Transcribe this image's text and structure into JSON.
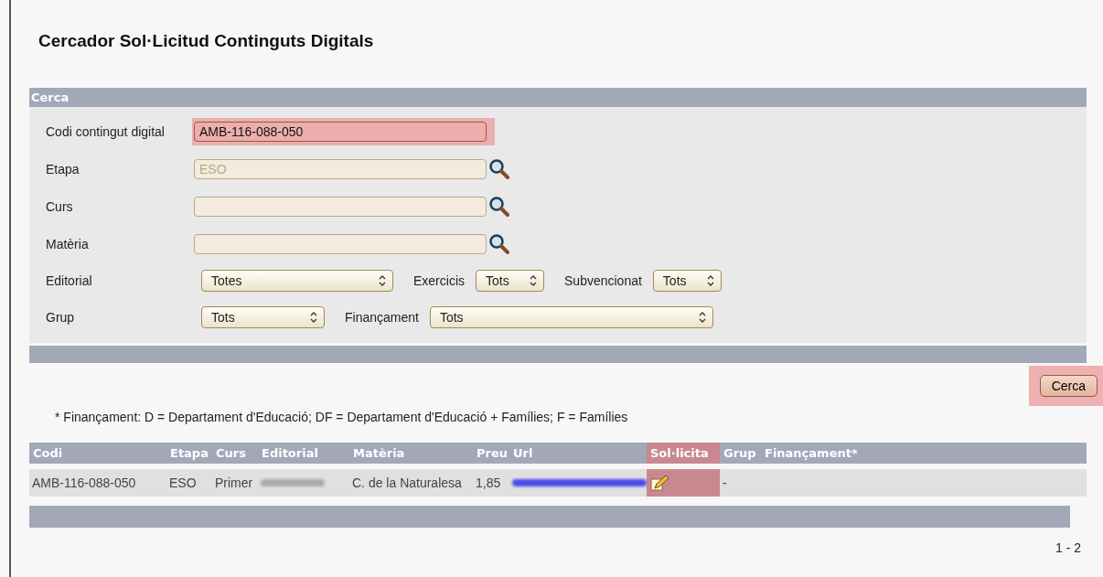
{
  "title": "Cercador Sol·Licitud Continguts Digitals",
  "search_section": {
    "heading": "Cerca",
    "text_fields": [
      {
        "label": "Codi contingut digital",
        "value": "AMB-116-088-050",
        "kind": "text",
        "highlighted": true
      },
      {
        "label": "Etapa",
        "value": "ESO",
        "kind": "lookup",
        "highlighted": false
      },
      {
        "label": "Curs",
        "kind": "lookup",
        "highlighted": false
      },
      {
        "label": "Matèria",
        "kind": "lookup",
        "highlighted": false
      }
    ],
    "select_rows": [
      [
        {
          "label": "Editorial",
          "value": "Totes"
        },
        {
          "label": "Exercicis",
          "value": "Tots"
        },
        {
          "label": "Subvencionat",
          "value": "Tots"
        }
      ],
      [
        {
          "label": "Grup",
          "value": "Tots"
        },
        {
          "label": "Finançament",
          "value": "Tots"
        }
      ]
    ]
  },
  "search_button": {
    "label": "Cerca",
    "highlighted": true
  },
  "footnote": "* Finançament: D = Departament d'Educació; DF = Departament d'Educació + Famílies; F = Famílies",
  "table": {
    "columns": [
      {
        "label": "Codi",
        "highlighted": false
      },
      {
        "label": "Etapa",
        "highlighted": false
      },
      {
        "label": "Curs",
        "highlighted": false
      },
      {
        "label": "Editorial",
        "highlighted": false
      },
      {
        "label": "Matèria",
        "highlighted": false
      },
      {
        "label": "Preu",
        "highlighted": false
      },
      {
        "label": "Url",
        "highlighted": false
      },
      {
        "label": "Sol·licita",
        "highlighted": true
      },
      {
        "label": "Grup",
        "highlighted": false
      },
      {
        "label": "Finançament*",
        "highlighted": false
      }
    ],
    "rows": [
      {
        "cells": [
          {
            "kind": "text",
            "text": "AMB-116-088-050"
          },
          {
            "kind": "text",
            "text": "ESO"
          },
          {
            "kind": "text",
            "text": "Primer"
          },
          {
            "kind": "blurred"
          },
          {
            "kind": "text",
            "text": "C. de la Naturalesa"
          },
          {
            "kind": "text",
            "text": "1,85"
          },
          {
            "kind": "blurred_link"
          },
          {
            "kind": "edit"
          },
          {
            "kind": "text",
            "text": "-"
          },
          {
            "kind": "empty"
          }
        ]
      }
    ]
  },
  "pagination": "1 - 2"
}
